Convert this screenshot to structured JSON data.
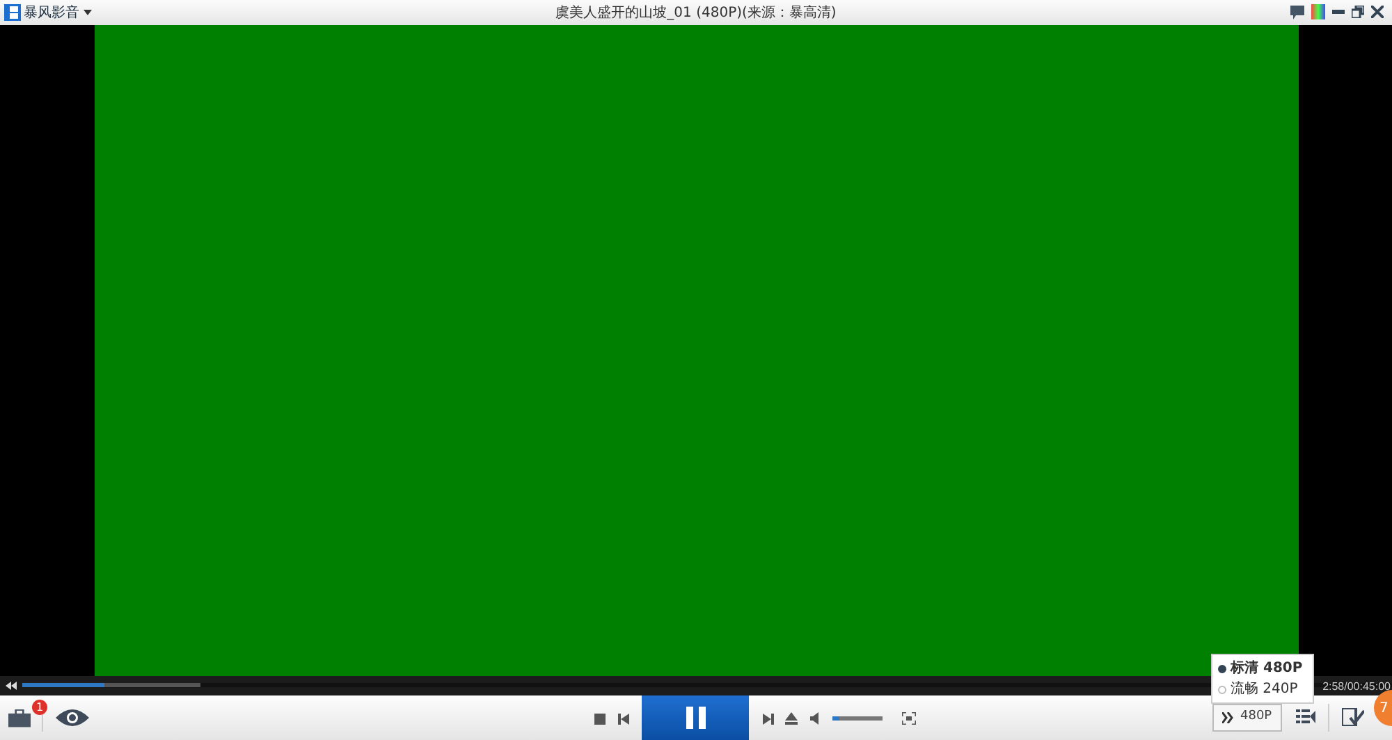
{
  "app": {
    "name": "暴风影音"
  },
  "window": {
    "title": "虞美人盛开的山坡_01 (480P)(来源：暴高清)"
  },
  "progress": {
    "level": 0.06,
    "buffered": {
      "level": 0.13
    }
  },
  "time": "2:58/00:45:00",
  "playing": true,
  "volume": {
    "level": 0.15
  },
  "notifications": {
    "count": "1"
  },
  "quality": {
    "label": "480P",
    "options": [
      {
        "label": "标清 480P",
        "selected": true
      },
      {
        "label": "流畅 240P",
        "selected": false
      }
    ]
  },
  "corner_badge": "7"
}
